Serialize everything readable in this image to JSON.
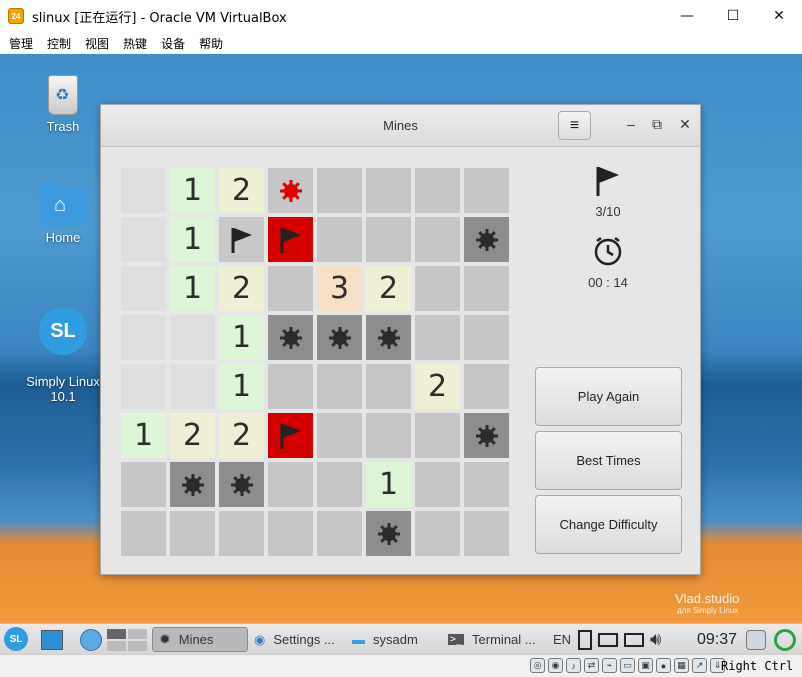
{
  "host_window": {
    "title": "slinux [正在运行] - Oracle VM VirtualBox",
    "app_icon_text": "24",
    "minimize": "—",
    "maximize": "☐",
    "close": "✕",
    "menu": [
      "管理",
      "控制",
      "视图",
      "热键",
      "设备",
      "帮助"
    ]
  },
  "desktop": {
    "icons": [
      {
        "label": "Trash",
        "icon": "trash-icon"
      },
      {
        "label": "Home",
        "icon": "home-folder-icon"
      },
      {
        "label": "Simply Linux\n10.1",
        "icon": "simply-linux-icon",
        "glyph": "SL"
      }
    ],
    "watermark": {
      "title": "Vlad.studio",
      "subtitle": "для Simply Linux"
    }
  },
  "mines": {
    "title": "Mines",
    "menu_glyph": "≡",
    "minimize": "–",
    "maximize": "⧉",
    "close": "✕",
    "flags_text": "3/10",
    "timer_text": "00 : 14",
    "buttons": {
      "play_again": "Play Again",
      "best_times": "Best Times",
      "change_difficulty": "Change Difficulty"
    },
    "board": [
      [
        "empty",
        "1",
        "2",
        "exploded",
        "hidden",
        "hidden",
        "hidden",
        "hidden"
      ],
      [
        "empty",
        "1",
        "flag",
        "redflag",
        "hidden",
        "hidden",
        "hidden",
        "mine"
      ],
      [
        "empty",
        "1",
        "2",
        "hidden",
        "3",
        "2",
        "hidden",
        "hidden"
      ],
      [
        "empty",
        "empty",
        "1",
        "mine",
        "mine",
        "mine",
        "hidden",
        "hidden"
      ],
      [
        "empty",
        "empty",
        "1",
        "hidden",
        "hidden",
        "hidden",
        "2",
        "hidden"
      ],
      [
        "1",
        "2",
        "2",
        "redflag",
        "hidden",
        "hidden",
        "hidden",
        "mine"
      ],
      [
        "hidden",
        "mine",
        "mine",
        "hidden",
        "hidden",
        "1",
        "hidden",
        "hidden"
      ],
      [
        "hidden",
        "hidden",
        "hidden",
        "hidden",
        "hidden",
        "mine",
        "hidden",
        "hidden"
      ]
    ],
    "colors": {
      "redflag": "#d40000",
      "exploded_mine": "#e00000",
      "mine": "#2b2b2b"
    }
  },
  "taskbar": {
    "start_text": "SL",
    "apps": [
      {
        "label": "Mines",
        "icon": "mines-icon",
        "active": true
      },
      {
        "label": "Settings ...",
        "icon": "settings-icon"
      },
      {
        "label": "sysadm",
        "icon": "folder-icon"
      },
      {
        "label": "Terminal ...",
        "icon": "terminal-icon"
      }
    ],
    "language": "EN",
    "clock": "09:37"
  },
  "vb_status": {
    "host_key": "Right Ctrl"
  }
}
